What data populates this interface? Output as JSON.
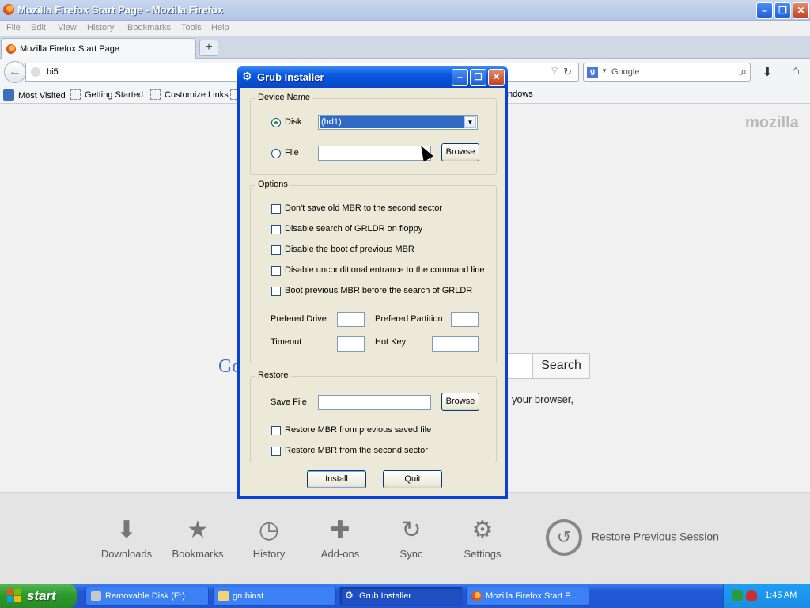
{
  "firefox": {
    "window_title": "Mozilla Firefox Start Page - Mozilla Firefox",
    "menu": [
      "File",
      "Edit",
      "View",
      "History",
      "Bookmarks",
      "Tools",
      "Help"
    ],
    "tab_title": "Mozilla Firefox Start Page",
    "new_tab_label": "+",
    "url": "bi5",
    "search_placeholder": "Google",
    "bookmarks": [
      "Most Visited",
      "Getting Started",
      "Customize Links",
      "ndows"
    ],
    "page": {
      "mozilla_logo": "mozilla",
      "google_fragment": "Go",
      "search_button": "Search",
      "about_fragment": "your browser,"
    },
    "launcher": [
      "Downloads",
      "Bookmarks",
      "History",
      "Add-ons",
      "Sync",
      "Settings"
    ],
    "restore_session": "Restore Previous Session"
  },
  "dialog": {
    "title": "Grub Installer",
    "device_group": "Device Name",
    "disk_label": "Disk",
    "disk_value": "(hd1)",
    "file_label": "File",
    "browse": "Browse",
    "options_group": "Options",
    "options": [
      "Don't save old MBR to the second sector",
      "Disable search of GRLDR on floppy",
      "Disable the boot of previous MBR",
      "Disable unconditional entrance to the command line",
      "Boot previous MBR before the search of GRLDR"
    ],
    "prefered_drive": "Prefered Drive",
    "prefered_partition": "Prefered Partition",
    "timeout": "Timeout",
    "hot_key": "Hot Key",
    "restore_group": "Restore",
    "save_file": "Save File",
    "restore_options": [
      "Restore MBR from previous saved file",
      "Restore MBR from the second sector"
    ],
    "install": "Install",
    "quit": "Quit"
  },
  "taskbar": {
    "start": "start",
    "tasks": [
      "Removable Disk (E:)",
      "grubinst",
      "Grub Installer",
      "Mozilla Firefox Start P..."
    ],
    "clock": "1:45 AM"
  }
}
